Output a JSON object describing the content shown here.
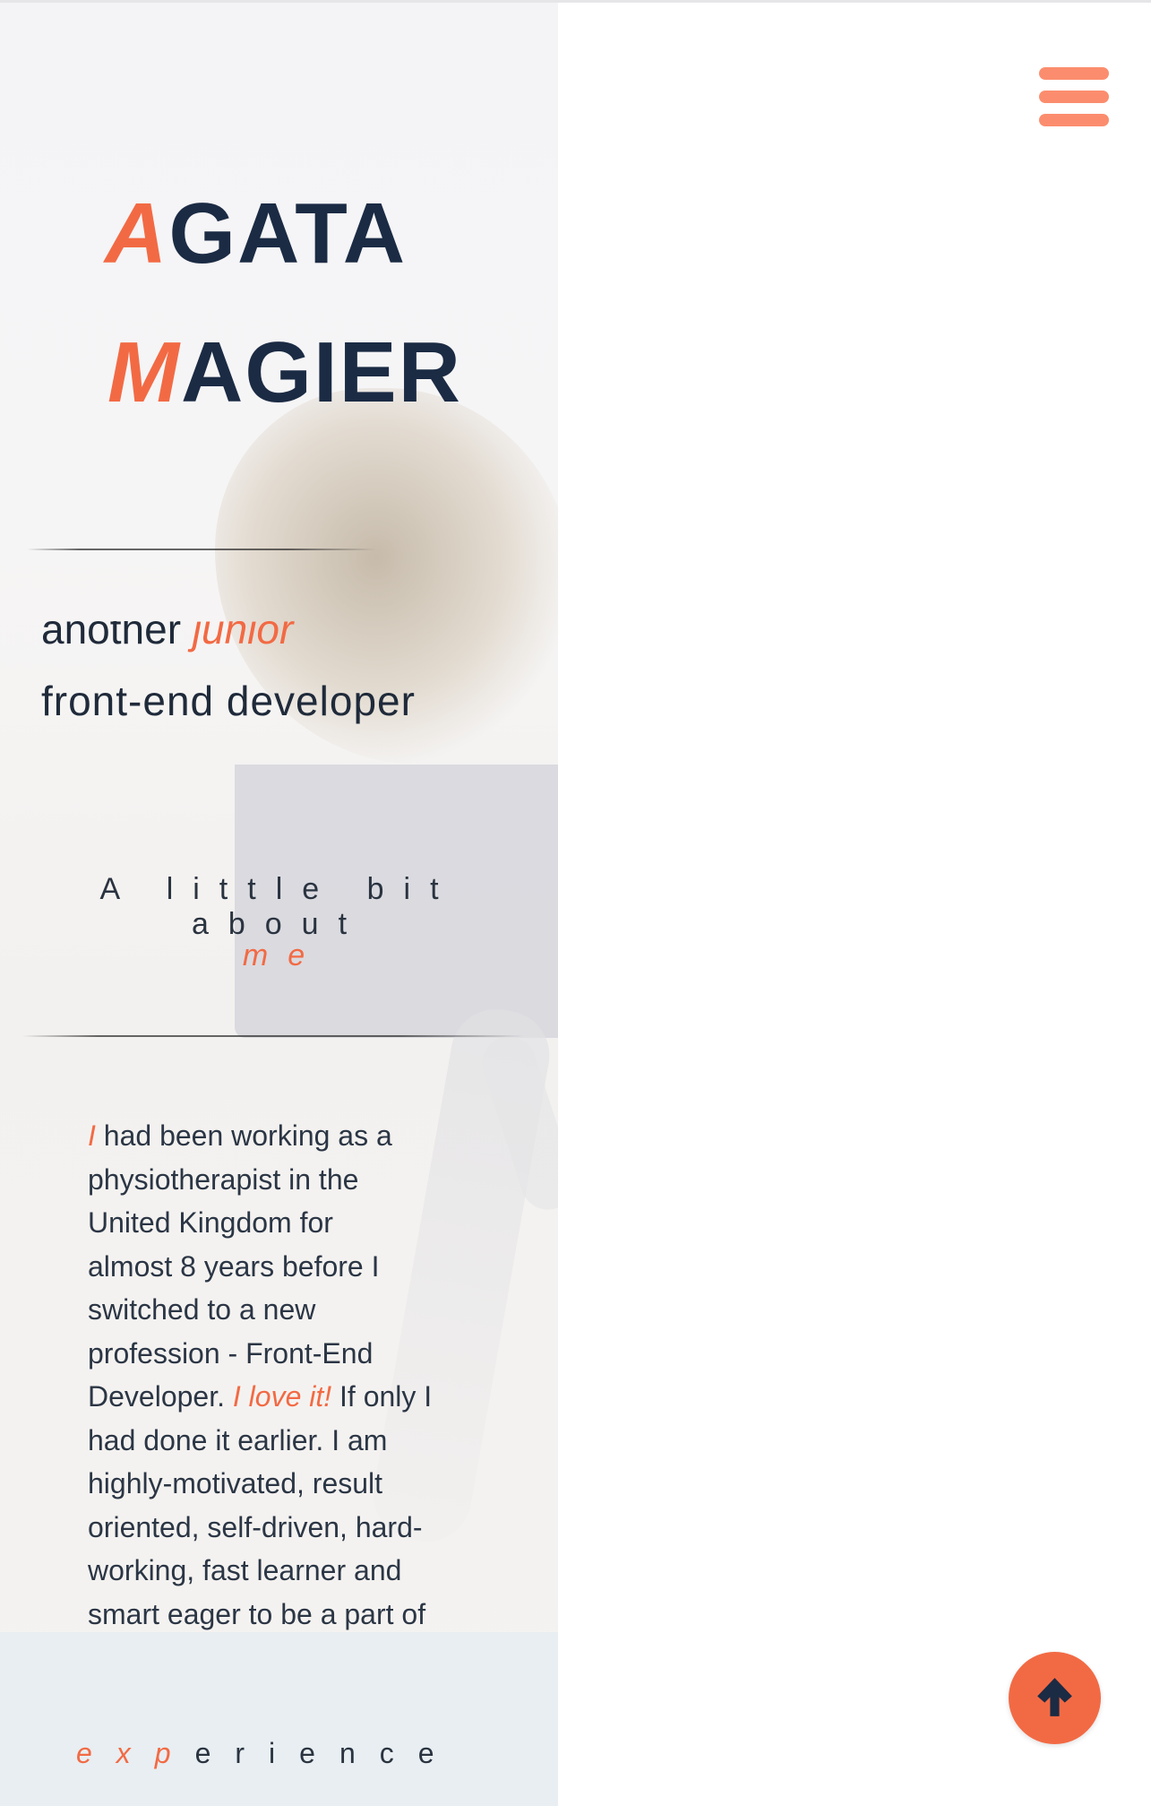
{
  "header": {
    "name_first_initial": "A",
    "name_first_rest": "GATA",
    "name_last_initial": "M",
    "name_last_rest": "AGIER",
    "tagline_line1_prefix": "another ",
    "tagline_line1_accent": "junior",
    "tagline_line2": "front-end developer"
  },
  "about": {
    "title_prefix": "A little bit about",
    "title_accent": "me",
    "text": {
      "lead_accent": "I",
      "line1_rest": " had been working as a",
      "line2": "physiotherapist in the",
      "line3": "United Kingdom for",
      "line4": "almost 8 years before I",
      "line5": "switched to a new",
      "line6": "profession - Front-End",
      "line7_prefix": "Developer. ",
      "line7_accent": "I love it!",
      "line7_suffix": " If only I",
      "line8": "had done it earlier. I am",
      "line9": "highly-motivated, result",
      "line10": "oriented, self-driven, hard-",
      "line11": "working, fast learner and",
      "line12": "smart eager to be a part of"
    }
  },
  "experience": {
    "title_accent": "exp",
    "title_rest": "erience"
  },
  "controls": {
    "menu_icon": "hamburger-menu-icon",
    "to_top_icon": "arrow-up-icon"
  },
  "colors": {
    "accent": "#f26a44",
    "navy": "#1b2b44",
    "menu": "#fb8d6e",
    "band": "#e8eef1"
  }
}
